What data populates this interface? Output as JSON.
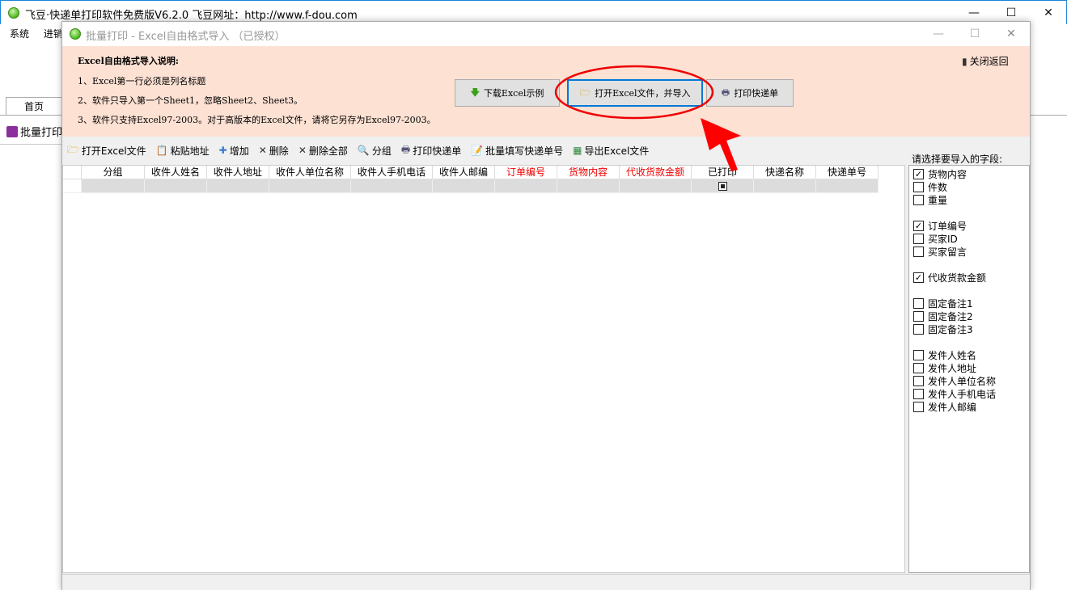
{
  "main_window": {
    "title": "飞豆·快递单打印软件免费版V6.2.0  飞豆网址：http://www.f-dou.com",
    "menu": [
      "系统",
      "进销"
    ],
    "tab": "首页",
    "side_item": "批量打印"
  },
  "dialog": {
    "title": "批量打印 - Excel自由格式导入 （已授权）",
    "instructions": {
      "heading": "Excel自由格式导入说明:",
      "lines": [
        "1、Excel第一行必须是列名标题",
        "2、软件只导入第一个Sheet1，忽略Sheet2、Sheet3。",
        "3、软件只支持Excel97-2003。对于高版本的Excel文件，请将它另存为Excel97-2003。"
      ]
    },
    "close_return": "关闭返回",
    "buttons": {
      "download": "下载Excel示例",
      "open_import": "打开Excel文件，并导入",
      "print": "打印快递单"
    },
    "toolbar": [
      "打开Excel文件",
      "粘贴地址",
      "增加",
      "删除",
      "删除全部",
      "分组",
      "打印快递单",
      "批量填写快递单号",
      "导出Excel文件"
    ],
    "columns": [
      {
        "label": "分组",
        "red": false
      },
      {
        "label": "收件人姓名",
        "red": false
      },
      {
        "label": "收件人地址",
        "red": false
      },
      {
        "label": "收件人单位名称",
        "red": false
      },
      {
        "label": "收件人手机电话",
        "red": false
      },
      {
        "label": "收件人邮编",
        "red": false
      },
      {
        "label": "订单编号",
        "red": true
      },
      {
        "label": "货物内容",
        "red": true
      },
      {
        "label": "代收货款金额",
        "red": true
      },
      {
        "label": "已打印",
        "red": false
      },
      {
        "label": "快递名称",
        "red": false
      },
      {
        "label": "快递单号",
        "red": false
      }
    ],
    "fields_label": "请选择要导入的字段:",
    "fields": [
      {
        "label": "货物内容",
        "checked": true
      },
      {
        "label": "件数",
        "checked": false
      },
      {
        "label": "重量",
        "checked": false
      },
      {
        "label": "订单编号",
        "checked": true
      },
      {
        "label": "买家ID",
        "checked": false
      },
      {
        "label": "买家留言",
        "checked": false
      },
      {
        "label": "代收货款金额",
        "checked": true
      },
      {
        "label": "固定备注1",
        "checked": false
      },
      {
        "label": "固定备注2",
        "checked": false
      },
      {
        "label": "固定备注3",
        "checked": false
      },
      {
        "label": "发件人姓名",
        "checked": false
      },
      {
        "label": "发件人地址",
        "checked": false
      },
      {
        "label": "发件人单位名称",
        "checked": false
      },
      {
        "label": "发件人手机电话",
        "checked": false
      },
      {
        "label": "发件人邮编",
        "checked": false
      }
    ]
  },
  "colors": {
    "pink": "#fde1d3",
    "accent": "#0078d7",
    "annotation": "#ff0000"
  }
}
